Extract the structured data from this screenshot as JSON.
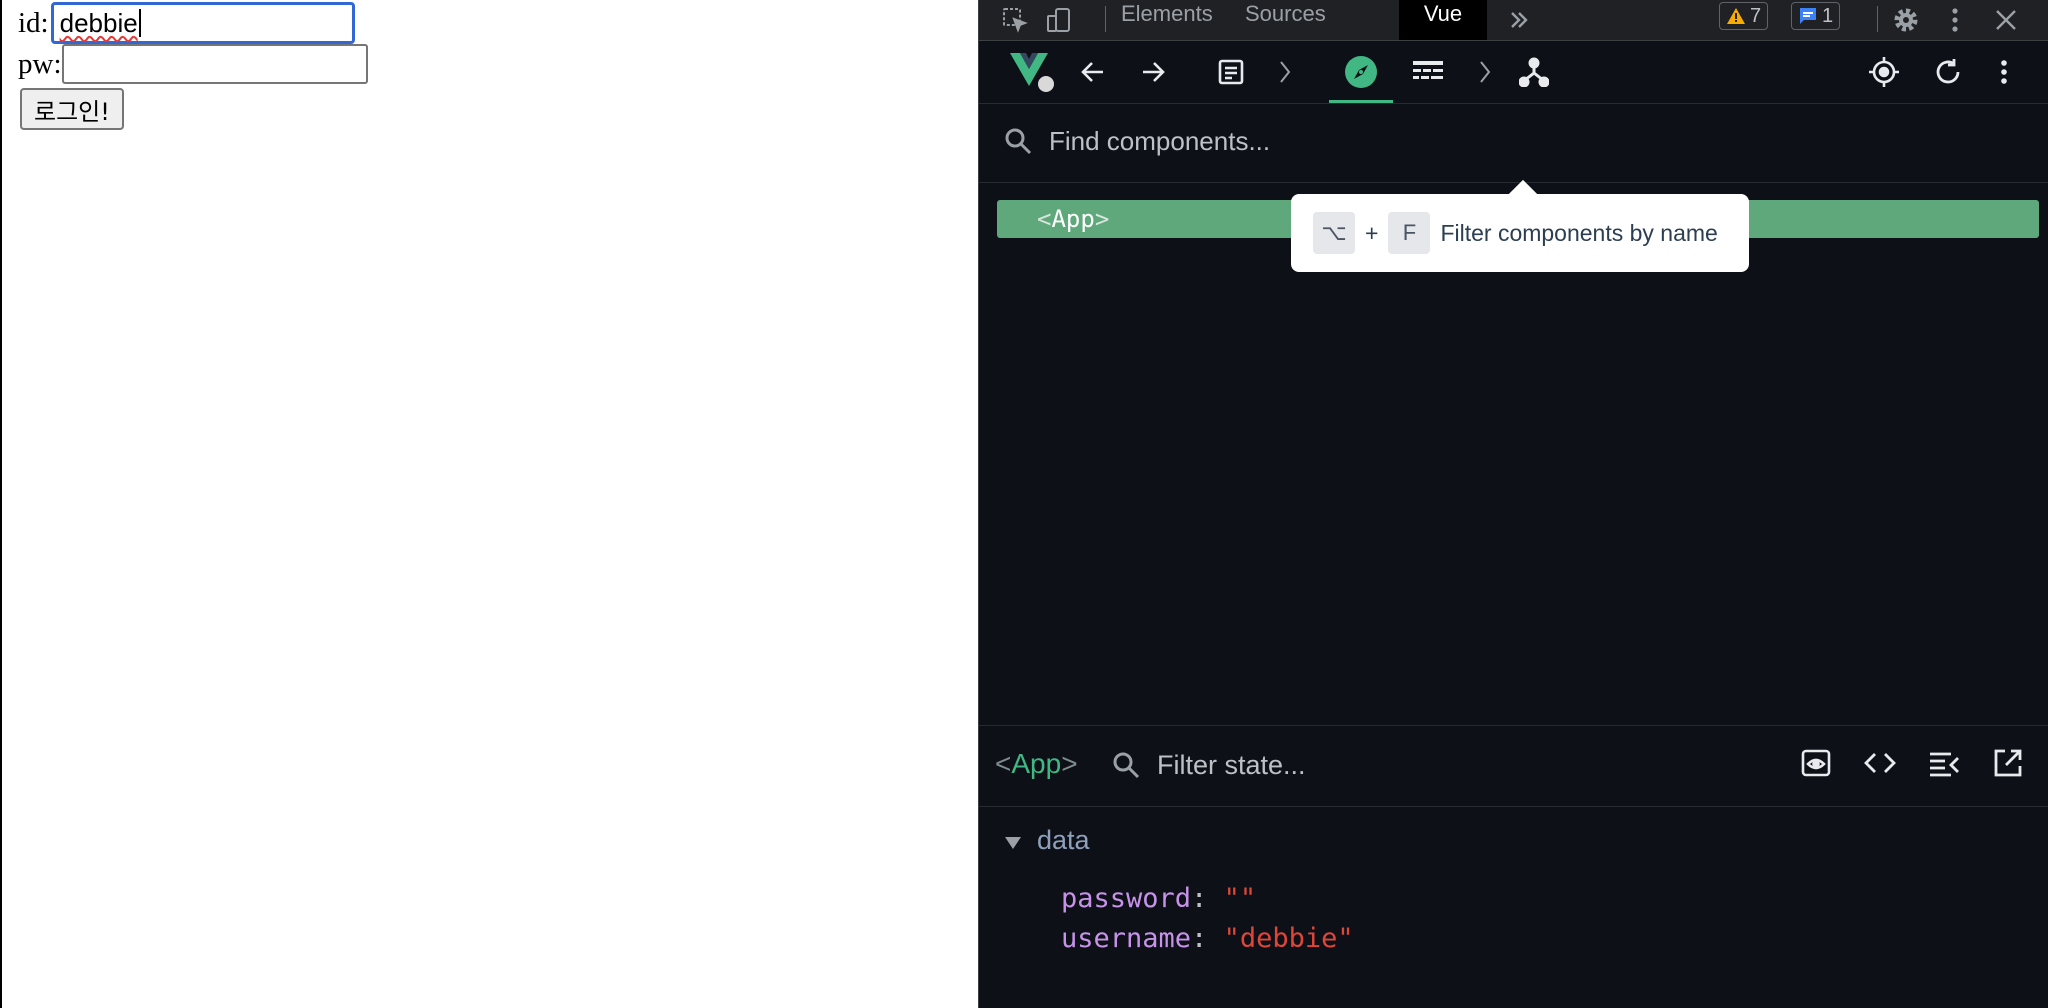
{
  "page": {
    "id_label": "id:",
    "id_value": "debbie",
    "pw_label": "pw:",
    "pw_value": "",
    "login_button": "로그인!"
  },
  "devtools": {
    "tabs": [
      "Elements",
      "Sources",
      "Vue"
    ],
    "active_tab": "Vue",
    "warning_count": "7",
    "message_count": "1",
    "search_placeholder": "Find components...",
    "tree": {
      "component": "App",
      "open": "<",
      "close": ">"
    },
    "tooltip": {
      "key1": "⌥",
      "plus": "+",
      "key2": "F",
      "text": "Filter components by name"
    },
    "state": {
      "component": "App",
      "open": "<",
      "close": ">",
      "filter_placeholder": "Filter state...",
      "section": "data",
      "props": [
        {
          "key": "password",
          "value": "\"\""
        },
        {
          "key": "username",
          "value": "\"debbie\""
        }
      ]
    },
    "colors": {
      "vue_green": "#41b883",
      "selected_row": "#5fa87b",
      "string_value": "#e0453a",
      "key": "#c792ea"
    }
  }
}
